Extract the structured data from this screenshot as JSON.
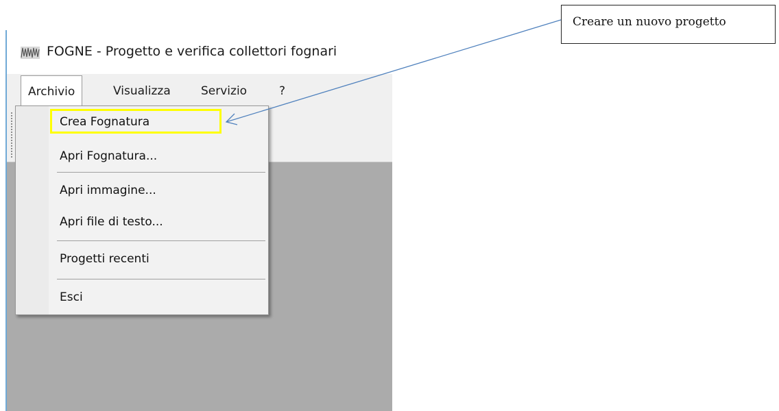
{
  "window": {
    "title": "FOGNE - Progetto e verifica collettori fognari",
    "icon": "app-icon"
  },
  "menubar": {
    "items": [
      {
        "label": "Archivio"
      },
      {
        "label": "Visualizza"
      },
      {
        "label": "Servizio"
      },
      {
        "label": "?"
      }
    ]
  },
  "dropdown": {
    "items": [
      {
        "label": "Crea Fognatura"
      },
      {
        "label": "Apri Fognatura..."
      },
      {
        "label": "Apri immagine..."
      },
      {
        "label": "Apri file di testo..."
      },
      {
        "label": "Progetti recenti"
      },
      {
        "label": "Esci"
      }
    ]
  },
  "callout": {
    "text": "Creare un nuovo progetto"
  },
  "colors": {
    "highlight": "#ffff00",
    "arrow": "#4f81bd",
    "client_area": "#ababab"
  }
}
